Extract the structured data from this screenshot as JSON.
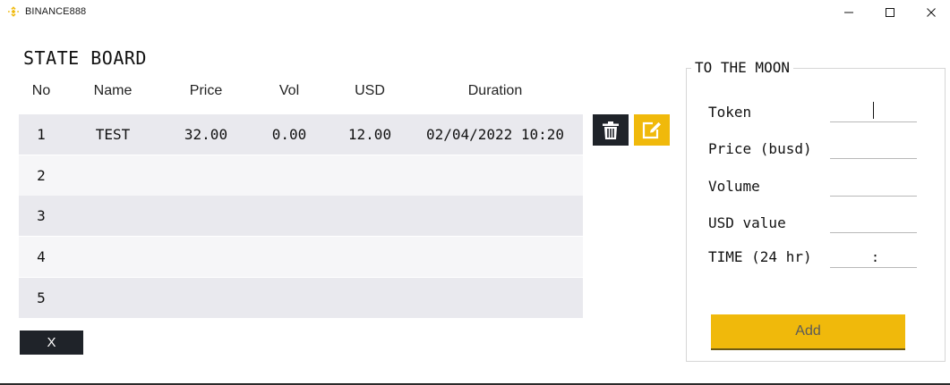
{
  "window": {
    "title": "BINANCE888",
    "minimize_glyph": "—",
    "maximize_glyph": "☐",
    "close_glyph": "✕"
  },
  "colors": {
    "accent": "#f0b90b",
    "dark": "#1f2329",
    "row_alt": "#e9e9ee",
    "row_plain": "#f6f6f8"
  },
  "board": {
    "title": "STATE BOARD",
    "columns": [
      "No",
      "Name",
      "Price",
      "Vol",
      "USD",
      "Duration"
    ],
    "rows": [
      {
        "no": "1",
        "name": "TEST",
        "price": "32.00",
        "vol": "0.00",
        "usd": "12.00",
        "duration": "02/04/2022 10:20"
      },
      {
        "no": "2",
        "name": "",
        "price": "",
        "vol": "",
        "usd": "",
        "duration": ""
      },
      {
        "no": "3",
        "name": "",
        "price": "",
        "vol": "",
        "usd": "",
        "duration": ""
      },
      {
        "no": "4",
        "name": "",
        "price": "",
        "vol": "",
        "usd": "",
        "duration": ""
      },
      {
        "no": "5",
        "name": "",
        "price": "",
        "vol": "",
        "usd": "",
        "duration": ""
      }
    ],
    "delete_icon": "trash-icon",
    "edit_icon": "edit-icon",
    "close_button_label": "X"
  },
  "form": {
    "title": "TO THE MOON",
    "fields": {
      "token": {
        "label": "Token",
        "value": ""
      },
      "price": {
        "label": "Price (busd)",
        "value": ""
      },
      "volume": {
        "label": "Volume",
        "value": ""
      },
      "usd_value": {
        "label": "USD value",
        "value": ""
      },
      "time": {
        "label": "TIME (24 hr)",
        "separator": ":"
      }
    },
    "add_button_label": "Add"
  }
}
